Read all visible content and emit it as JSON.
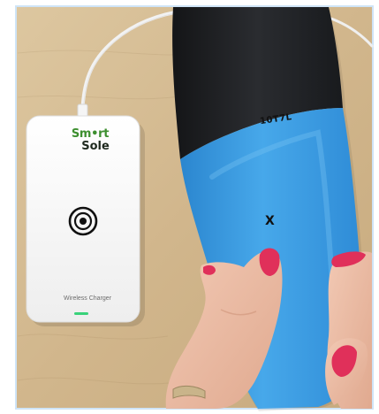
{
  "photo": {
    "charger": {
      "brand_line1": "Sm•rt",
      "brand_line2": "Sole",
      "caption": "Wireless Charger",
      "indicator_color": "#39d27a"
    },
    "insole": {
      "size_code": "10T7L",
      "mark": "X",
      "top_color": "#1f2124",
      "bottom_color": "#3a9fe0"
    },
    "colors": {
      "frame_border": "#cfe4f7",
      "table": "#d2b98f",
      "cable": "#f3f3f3",
      "nail_polish": "#e0305a"
    }
  }
}
